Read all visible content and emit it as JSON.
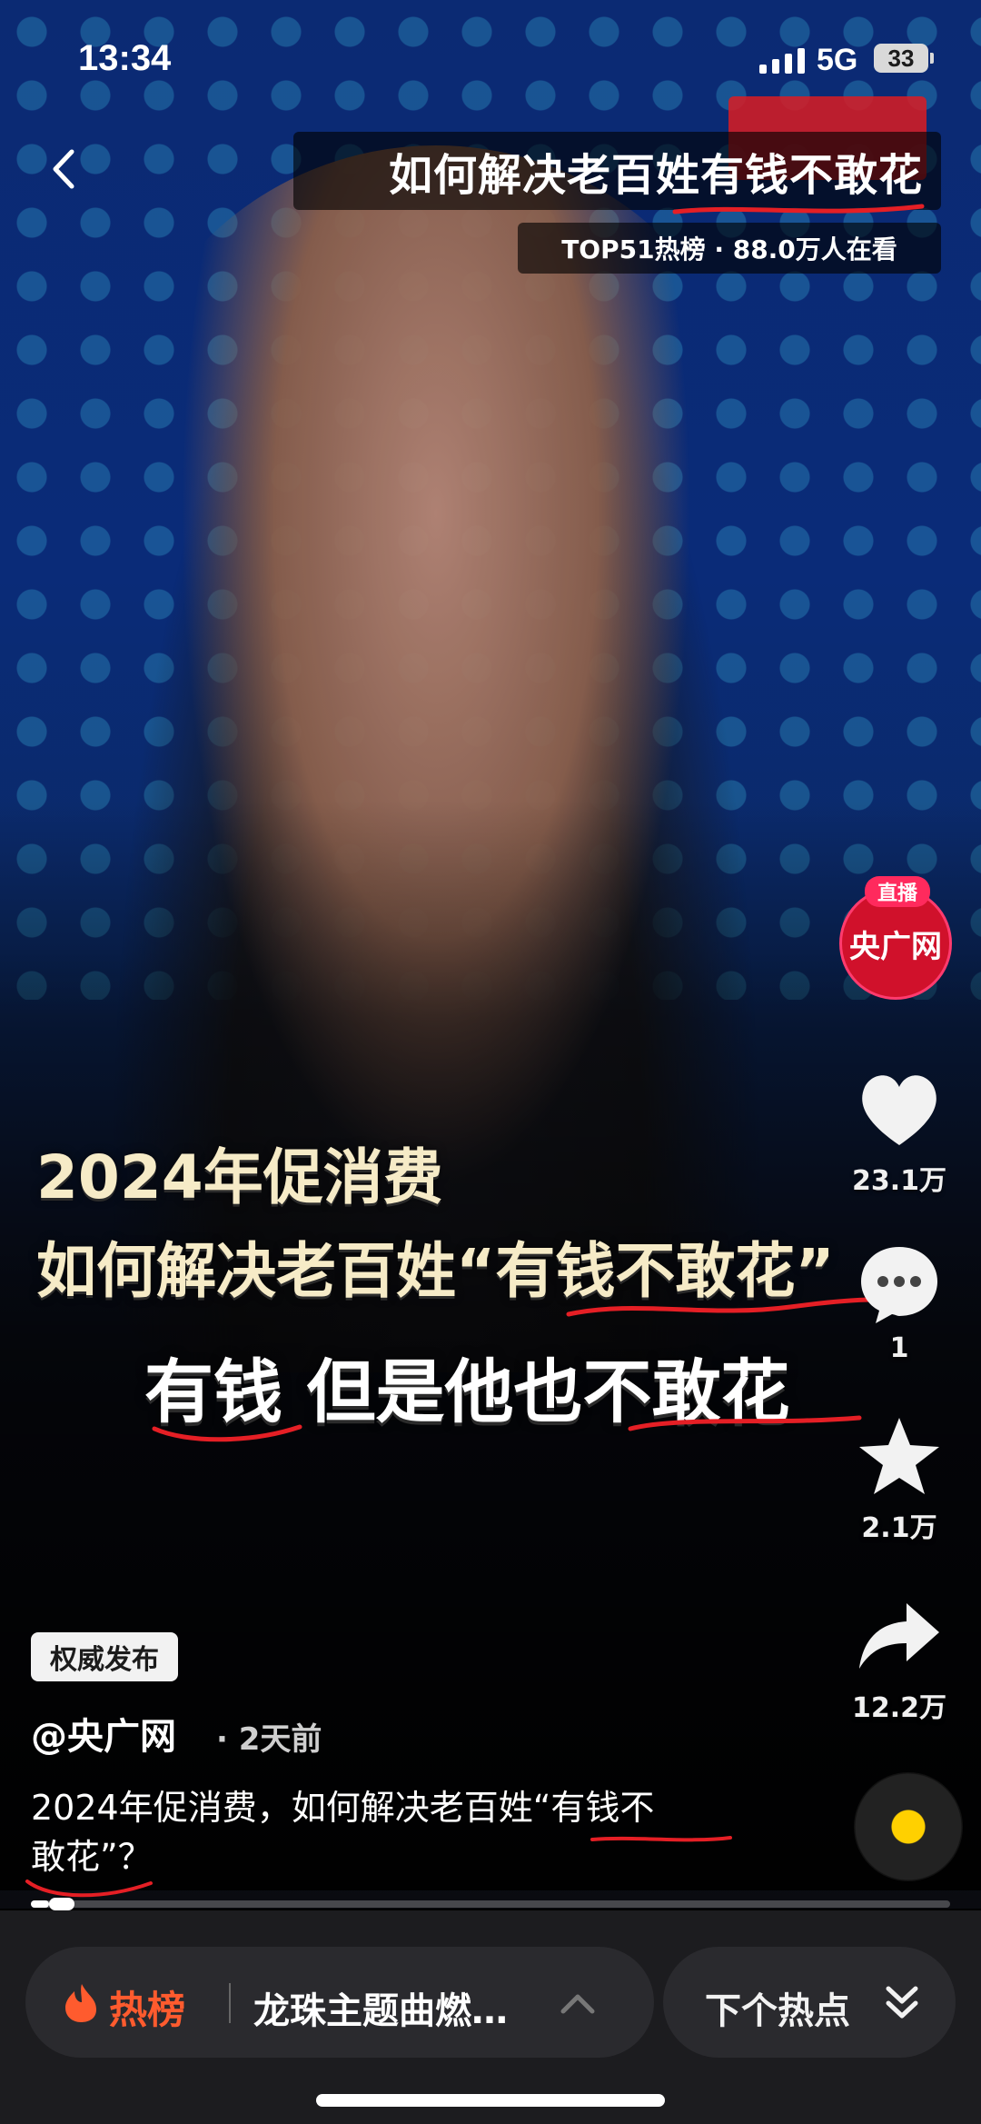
{
  "status_bar": {
    "time": "13:34",
    "network": "5G",
    "battery": "33"
  },
  "header": {
    "title": "如何解决老百姓有钱不敢花",
    "subtitle": "TOP51热榜 · 88.0万人在看"
  },
  "video": {
    "caption_line1": "2024年促消费",
    "caption_line2": "如何解决老百姓“有钱不敢花”",
    "caption_line3": "有钱 但是他也不敢花"
  },
  "rail": {
    "live_badge": "直播",
    "avatar_text": "央广网",
    "likes": "23.1万",
    "comments": "1",
    "favorites": "2.1万",
    "shares": "12.2万"
  },
  "post": {
    "badge": "权威发布",
    "author": "@央广网",
    "time": "· 2天前",
    "desc_line1": "2024年促消费，如何解决老百姓“有钱不",
    "desc_line2": "敢花”？"
  },
  "progress": {
    "fraction": 0.02
  },
  "bottom_bar": {
    "hot_label": "热榜",
    "hot_topic": "龙珠主题曲燃…",
    "next_label": "下个热点"
  },
  "colors": {
    "accent": "#ff5b2e",
    "live_red": "#ff2a5d",
    "annotation_red": "#e51f25"
  }
}
